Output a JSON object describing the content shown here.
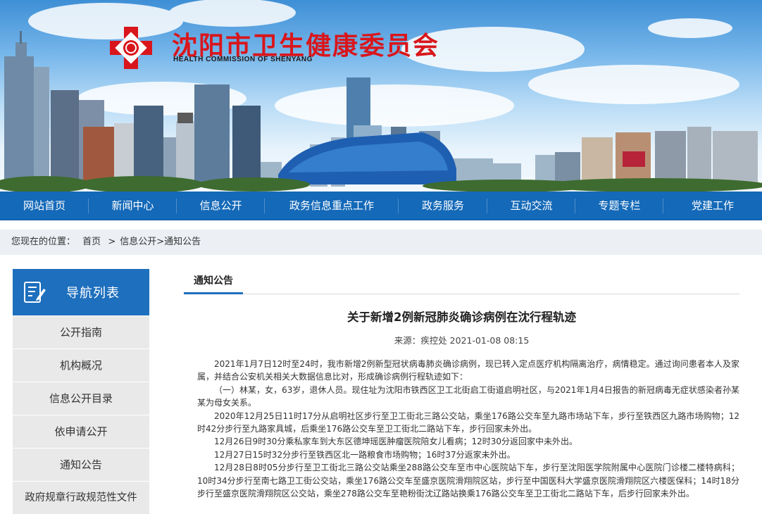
{
  "site": {
    "title": "沈阳市卫生健康委员会",
    "subtitle": "HEALTH COMMISSION OF SHENYANG",
    "logo_icon": "red-cross-diamond-logo-icon"
  },
  "nav": {
    "items": [
      {
        "label": "网站首页"
      },
      {
        "label": "新闻中心"
      },
      {
        "label": "信息公开"
      },
      {
        "label": "政务信息重点工作"
      },
      {
        "label": "政务服务"
      },
      {
        "label": "互动交流"
      },
      {
        "label": "专题专栏"
      },
      {
        "label": "党建工作"
      }
    ]
  },
  "breadcrumb": {
    "prefix": "您现在的位置：",
    "home": "首页",
    "sep": ">",
    "info": "信息公开",
    "sep2": ">",
    "current": "通知公告"
  },
  "sidebar": {
    "title": "导航列表",
    "icon": "document-edit-icon",
    "items": [
      {
        "label": "公开指南"
      },
      {
        "label": "机构概况"
      },
      {
        "label": "信息公开目录"
      },
      {
        "label": "依申请公开"
      },
      {
        "label": "通知公告"
      },
      {
        "label": "政府规章行政规范性文件"
      }
    ]
  },
  "content": {
    "tab": "通知公告",
    "title": "关于新增2例新冠肺炎确诊病例在沈行程轨迹",
    "meta": "来源：疾控处 2021-01-08 08:15",
    "paragraphs": [
      "2021年1月7日12时至24时，我市新增2例新型冠状病毒肺炎确诊病例，现已转入定点医疗机构隔离治疗，病情稳定。通过询问患者本人及家属，并结合公安机关相关大数据信息比对，形成确诊病例行程轨迹如下：",
      "（一）林某，女，63岁，退休人员。现住址为沈阳市铁西区卫工北街启工街道启明社区，与2021年1月4日报告的新冠病毒无症状感染者孙某某为母女关系。",
      "2020年12月25日11时17分从启明社区步行至卫工街北三路公交站，乘坐176路公交车至九路市场站下车，步行至铁西区九路市场购物；12时42分步行至九路家具城，后乘坐176路公交车至卫工街北二路站下车，步行回家未外出。",
      "12月26日9时30分乘私家车到大东区德坤瑶医肿瘤医院陪女儿看病；12时30分返回家中未外出。",
      "12月27日15时32分步行至铁西区北一路粮食市场购物；16时37分返家未外出。",
      "12月28日8时05分步行至卫工街北三路公交站乘坐288路公交车至市中心医院站下车，步行至沈阳医学院附属中心医院门诊楼二楼特病科；10时34分步行至南七路卫工街公交站，乘坐176路公交车至盛京医院滑翔院区站，步行至中国医科大学盛京医院滑翔院区六楼医保科；14时18分步行至盛京医院滑翔院区公交站，乘坐278路公交车至艳粉街沈辽路站换乘176路公交车至卫工街北二路站下车，后步行回家未外出。"
    ]
  },
  "colors": {
    "nav_bg": "#1469b8",
    "title_red": "#d9161c",
    "sidebar_header": "#1e6fbd",
    "sidebar_item_bg": "#e9e9e9"
  }
}
